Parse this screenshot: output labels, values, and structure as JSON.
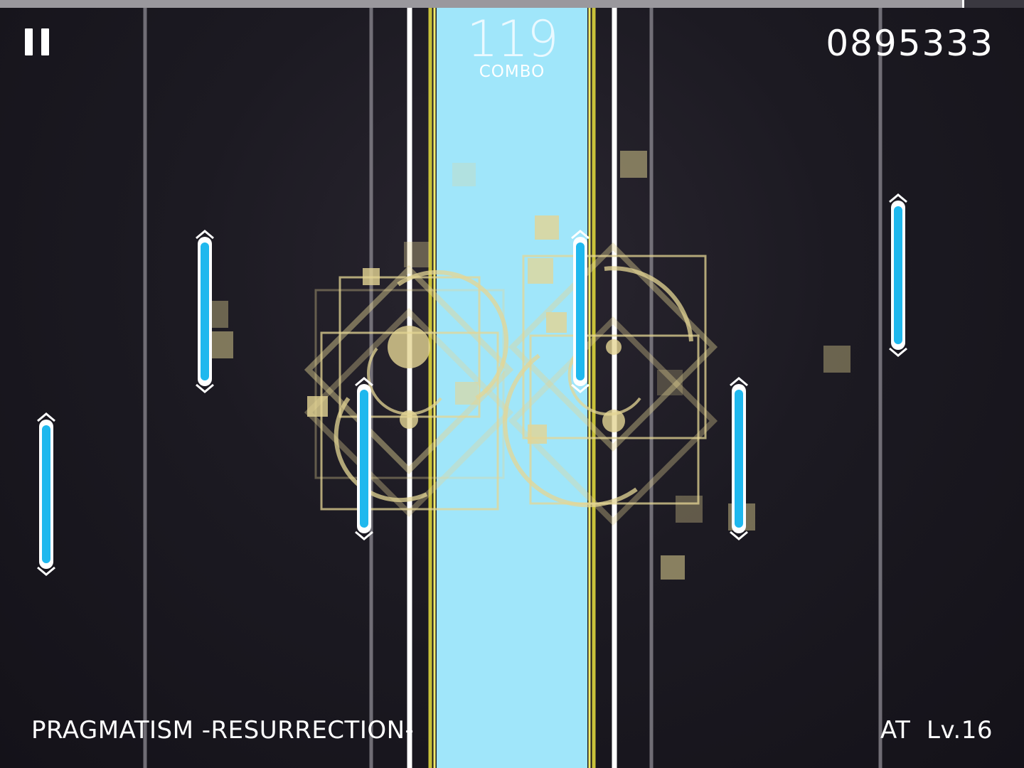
{
  "hud": {
    "combo_count": "119",
    "combo_label": "COMBO",
    "score": "0895333",
    "song_title": "PRAGMATISM -RESURRECTION-",
    "difficulty": "AT  Lv.16",
    "song_progress": 0.94
  },
  "icons": {
    "pause": "pause-icon"
  },
  "colors": {
    "note_fill": "#1fb8ee",
    "judge_lane": "#9fe6f8",
    "lane_border": "#d9d33a",
    "effect": "#e8d89a"
  },
  "notes": [
    {
      "lane": "lane-1",
      "type": "hold"
    },
    {
      "lane": "lane-2",
      "type": "hold"
    },
    {
      "lane": "lane-3",
      "type": "hold"
    },
    {
      "lane": "lane-5",
      "type": "hold"
    },
    {
      "lane": "lane-6",
      "type": "hold"
    },
    {
      "lane": "lane-7",
      "type": "hold"
    }
  ]
}
